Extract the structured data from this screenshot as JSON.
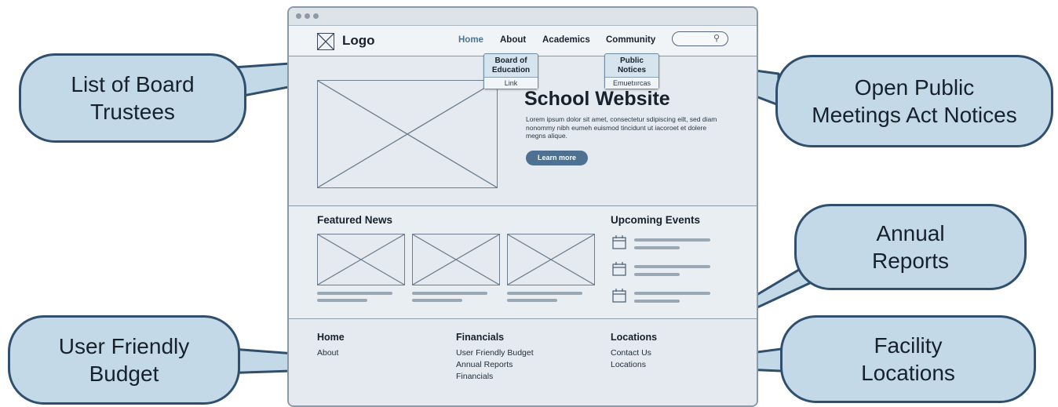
{
  "browser": {
    "controls": [
      "window-dot",
      "window-dot",
      "window-dot"
    ]
  },
  "nav": {
    "logo": "Logo",
    "links": [
      "Home",
      "About",
      "Academics",
      "Community"
    ]
  },
  "dropdown_about": {
    "header": "Board of Education",
    "item": "Link"
  },
  "dropdown_community": {
    "header": "Public Notices",
    "item": "Emuetıırcas"
  },
  "hero": {
    "title": "School Website",
    "body": "Lorem ipsum dolor sit amet, consectetur sdipiscing eilt, sed diam nonommy nibh eumeh euismod tincidunt ut iacoroet et dolere megns alique.",
    "button": "Learn more"
  },
  "sections": {
    "featured_news": "Featured News",
    "upcoming_events": "Upcoming Events"
  },
  "footer": {
    "col1": {
      "heading": "Home",
      "links": [
        "About"
      ]
    },
    "col2": {
      "heading": "Financials",
      "links": [
        "User Friendly Budget",
        "Annual Reports",
        "Financials"
      ]
    },
    "col3": {
      "heading": "Locations",
      "links": [
        "Contact Us",
        "Locations"
      ]
    }
  },
  "callouts": {
    "board_trustees": [
      "List of Board",
      "Trustees"
    ],
    "open_meetings": [
      "Open Public",
      "Meetings Act Notices"
    ],
    "annual_reports": [
      "Annual",
      "Reports"
    ],
    "budget": [
      "User Friendly",
      "Budget"
    ],
    "facility": [
      "Facility",
      "Locations"
    ]
  },
  "colors": {
    "accent": "#4e7191",
    "callout_fill": "#c4d9e8",
    "callout_border": "#2f4f6d"
  }
}
